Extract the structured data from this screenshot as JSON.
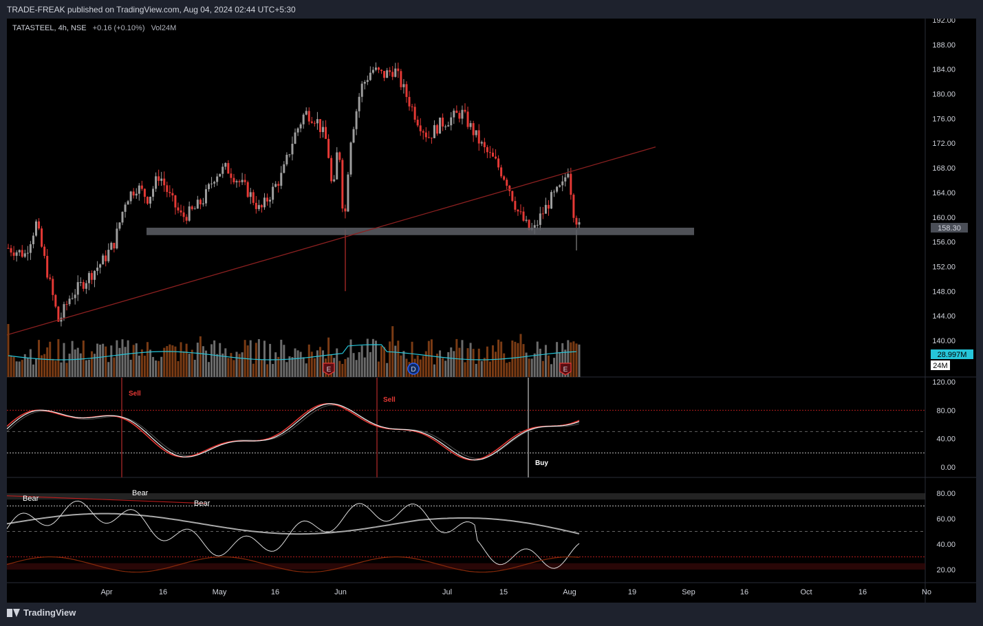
{
  "publisher_line": "TRADE-FREAK published on TradingView.com, Aug 04, 2024 02:44 UTC+5:30",
  "legend": {
    "symbol": "TATASTEEL, 4h, NSE",
    "change": "+0.16 (+0.10%)",
    "vol_label": "Vol",
    "vol_value": "24M"
  },
  "footer_brand": "TradingView",
  "colors": {
    "up": "#9e9e9e",
    "down": "#e53935",
    "trendline": "#8b2020",
    "support_zone": "#5d5f66",
    "vol_ma": "#26c6da",
    "vol_up": "#6b6b6b",
    "vol_down": "#7a3b14"
  },
  "chart_data": [
    {
      "type": "candlestick",
      "title": "",
      "y_ticks": [
        "192.00",
        "188.00",
        "184.00",
        "180.00",
        "176.00",
        "172.00",
        "168.00",
        "164.00",
        "160.00",
        "156.00",
        "152.00",
        "148.00",
        "144.00",
        "140.00"
      ],
      "ylim": [
        137.5,
        192
      ],
      "x_ticks": [
        "Apr",
        "16",
        "May",
        "16",
        "Jun",
        "Jul",
        "15",
        "Aug",
        "19",
        "Sep",
        "16",
        "Oct",
        "16",
        "No"
      ],
      "last_price_label": "158.30",
      "price_path": [
        {
          "t": 0,
          "c": 155
        },
        {
          "t": 3,
          "c": 154
        },
        {
          "t": 5,
          "c": 159
        },
        {
          "t": 7,
          "c": 151
        },
        {
          "t": 9,
          "c": 143
        },
        {
          "t": 11,
          "c": 147
        },
        {
          "t": 13,
          "c": 149
        },
        {
          "t": 15,
          "c": 151
        },
        {
          "t": 17,
          "c": 153
        },
        {
          "t": 19,
          "c": 156
        },
        {
          "t": 21,
          "c": 163
        },
        {
          "t": 23,
          "c": 165
        },
        {
          "t": 25,
          "c": 163
        },
        {
          "t": 27,
          "c": 167
        },
        {
          "t": 29,
          "c": 163
        },
        {
          "t": 31,
          "c": 160
        },
        {
          "t": 33,
          "c": 161
        },
        {
          "t": 35,
          "c": 163
        },
        {
          "t": 37,
          "c": 167
        },
        {
          "t": 39,
          "c": 168
        },
        {
          "t": 41,
          "c": 166
        },
        {
          "t": 43,
          "c": 164
        },
        {
          "t": 45,
          "c": 161
        },
        {
          "t": 47,
          "c": 164
        },
        {
          "t": 49,
          "c": 167
        },
        {
          "t": 51,
          "c": 173
        },
        {
          "t": 53,
          "c": 177
        },
        {
          "t": 55,
          "c": 176
        },
        {
          "t": 57,
          "c": 172
        },
        {
          "t": 58,
          "c": 163
        },
        {
          "t": 59,
          "c": 173
        },
        {
          "t": 60,
          "c": 158
        },
        {
          "t": 61,
          "c": 172
        },
        {
          "t": 63,
          "c": 181
        },
        {
          "t": 65,
          "c": 184
        },
        {
          "t": 67,
          "c": 183
        },
        {
          "t": 69,
          "c": 184
        },
        {
          "t": 71,
          "c": 180
        },
        {
          "t": 73,
          "c": 176
        },
        {
          "t": 75,
          "c": 173
        },
        {
          "t": 77,
          "c": 175
        },
        {
          "t": 79,
          "c": 176
        },
        {
          "t": 81,
          "c": 177
        },
        {
          "t": 83,
          "c": 174
        },
        {
          "t": 85,
          "c": 171
        },
        {
          "t": 87,
          "c": 169
        },
        {
          "t": 89,
          "c": 166
        },
        {
          "t": 91,
          "c": 161
        },
        {
          "t": 93,
          "c": 158
        },
        {
          "t": 94,
          "c": 158
        },
        {
          "t": 95,
          "c": 160
        },
        {
          "t": 97,
          "c": 163
        },
        {
          "t": 99,
          "c": 165
        },
        {
          "t": 100,
          "c": 168
        },
        {
          "t": 101,
          "c": 161
        },
        {
          "t": 102,
          "c": 158.3
        }
      ],
      "volume_label": "28.997M",
      "volume_last_label": "24M",
      "event_markers": [
        "E",
        "D",
        "E"
      ]
    },
    {
      "type": "line",
      "title": "",
      "y_ticks": [
        "120.00",
        "80.00",
        "40.00",
        "0.00"
      ],
      "ylim": [
        -10,
        130
      ],
      "levels": [
        80,
        50,
        20
      ],
      "annotations": [
        "Sell",
        "Sell",
        "Buy"
      ]
    },
    {
      "type": "line",
      "title": "",
      "y_ticks": [
        "80.00",
        "60.00",
        "40.00",
        "20.00"
      ],
      "ylim": [
        12,
        86
      ],
      "levels": [
        70,
        50,
        30
      ],
      "annotations": [
        "Bear",
        "Bear",
        "Bear"
      ]
    }
  ]
}
